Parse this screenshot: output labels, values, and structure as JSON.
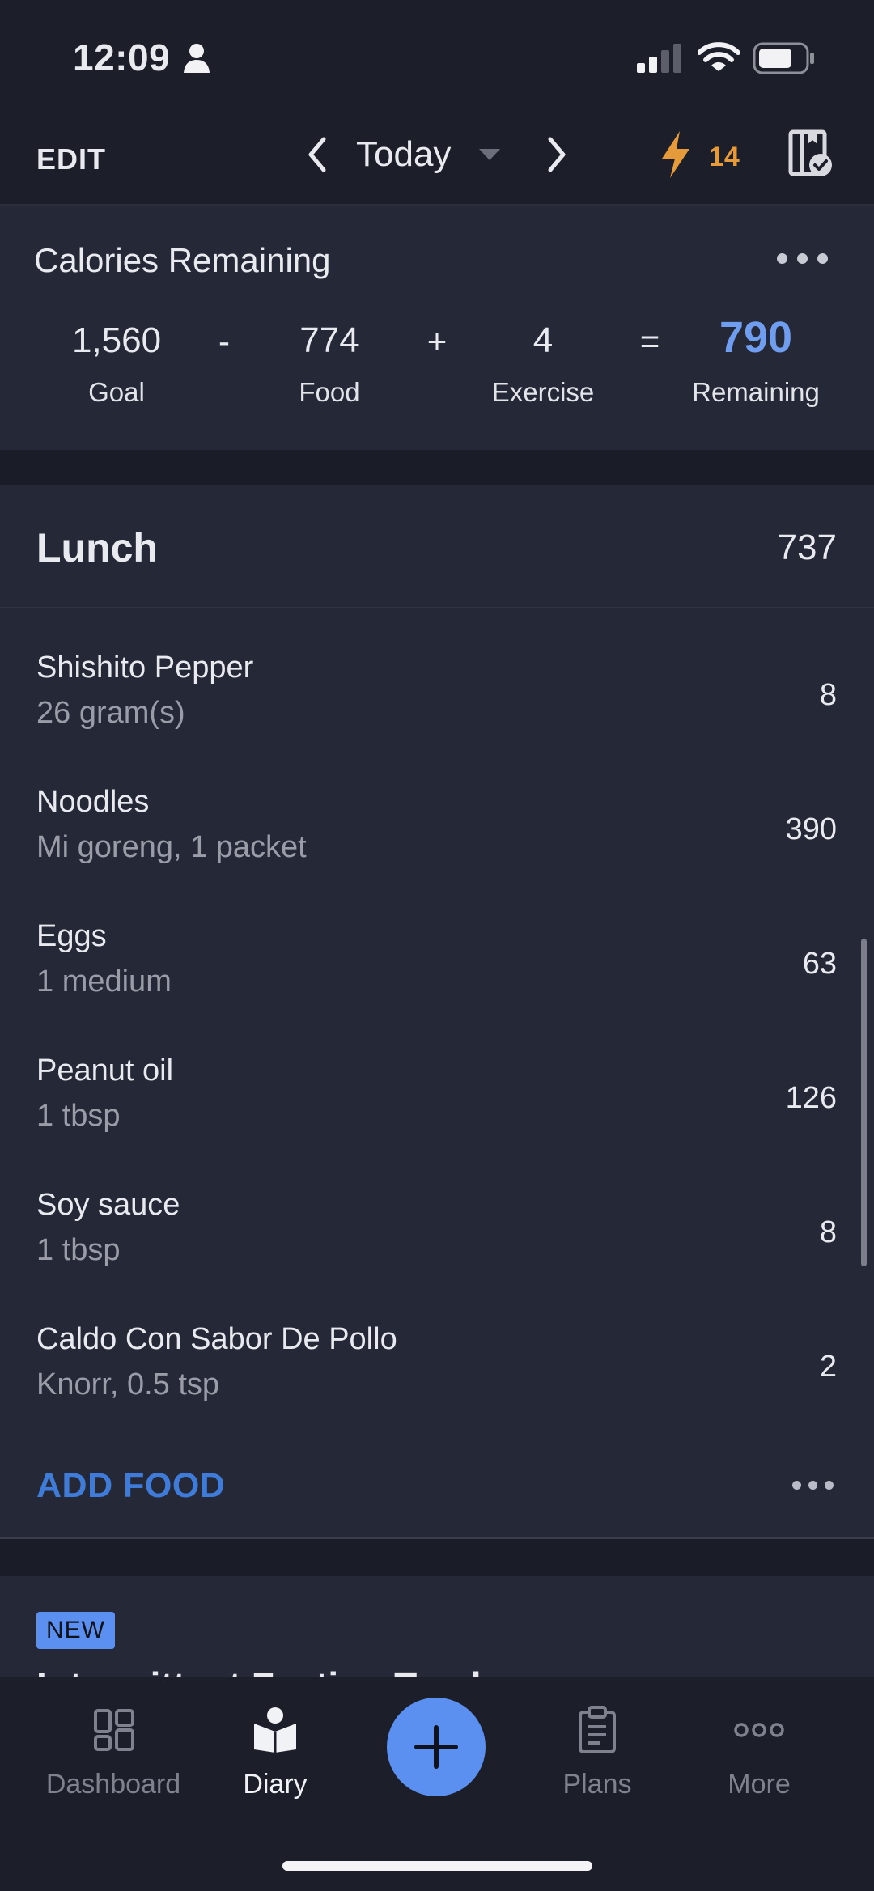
{
  "status_bar": {
    "time": "12:09"
  },
  "header": {
    "edit_label": "EDIT",
    "date_label": "Today",
    "streak_count": "14"
  },
  "calories": {
    "title": "Calories Remaining",
    "goal": {
      "value": "1,560",
      "label": "Goal"
    },
    "minus": "-",
    "food": {
      "value": "774",
      "label": "Food"
    },
    "plus": "+",
    "exercise": {
      "value": "4",
      "label": "Exercise"
    },
    "equals": "=",
    "remaining": {
      "value": "790",
      "label": "Remaining"
    }
  },
  "lunch": {
    "title": "Lunch",
    "total": "737",
    "items": [
      {
        "name": "Shishito Pepper",
        "detail": "26 gram(s)",
        "calories": "8"
      },
      {
        "name": "Noodles",
        "detail": "Mi goreng, 1 packet",
        "calories": "390"
      },
      {
        "name": "Eggs",
        "detail": "1 medium",
        "calories": "63"
      },
      {
        "name": "Peanut oil",
        "detail": "1 tbsp",
        "calories": "126"
      },
      {
        "name": "Soy sauce",
        "detail": "1 tbsp",
        "calories": "8"
      },
      {
        "name": "Caldo Con Sabor De Pollo",
        "detail": "Knorr, 0.5 tsp",
        "calories": "2"
      }
    ],
    "add_food_label": "ADD FOOD"
  },
  "promo": {
    "badge": "NEW",
    "title": "Intermittent Fasting Tracker"
  },
  "tabbar": {
    "tabs": [
      {
        "label": "Dashboard",
        "icon": "dashboard-grid-icon"
      },
      {
        "label": "Diary",
        "icon": "diary-book-icon"
      },
      {
        "label": "Plans",
        "icon": "clipboard-icon"
      },
      {
        "label": "More",
        "icon": "more-dots-icon"
      }
    ],
    "active": "Diary"
  },
  "colors": {
    "background": "#1a1d27",
    "card": "#252836",
    "accent_blue": "#5b8ff0",
    "remaining_blue": "#6f9ef0",
    "streak_orange": "#e59a3c",
    "add_food_blue": "#3f7bd8"
  }
}
